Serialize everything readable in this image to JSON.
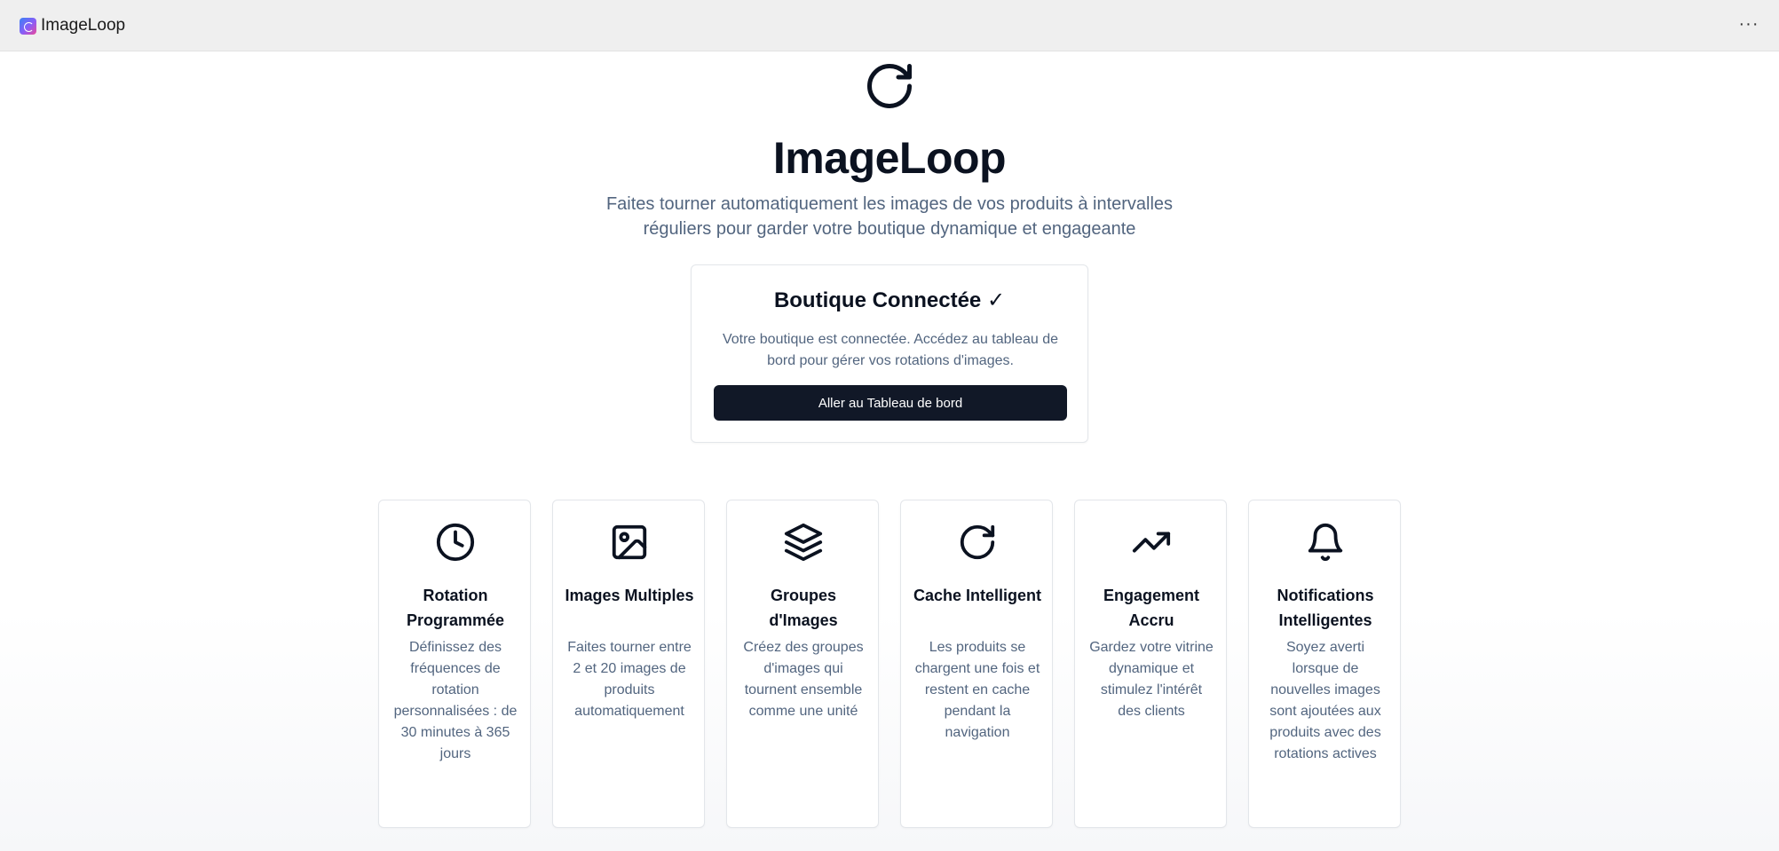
{
  "window": {
    "title": "ImageLoop",
    "menu_label": "···"
  },
  "hero": {
    "icon": "refresh-icon",
    "title": "ImageLoop",
    "subtitle": "Faites tourner automatiquement les images de vos produits à intervalles réguliers pour garder votre boutique dynamique et engageante"
  },
  "connected_card": {
    "title": "Boutique Connectée ✓",
    "description": "Votre boutique est connectée. Accédez au tableau de bord pour gérer vos rotations d'images.",
    "button_label": "Aller au Tableau de bord"
  },
  "features": [
    {
      "icon": "clock-icon",
      "title": "Rotation Programmée",
      "description": "Définissez des fréquences de rotation personnalisées : de 30 minutes à 365 jours"
    },
    {
      "icon": "image-icon",
      "title": "Images Multiples",
      "description": "Faites tourner entre 2 et 20 images de produits automatiquement"
    },
    {
      "icon": "layers-icon",
      "title": "Groupes d'Images",
      "description": "Créez des groupes d'images qui tournent ensemble comme une unité"
    },
    {
      "icon": "refresh-icon",
      "title": "Cache Intelligent",
      "description": "Les produits se chargent une fois et restent en cache pendant la navigation"
    },
    {
      "icon": "trending-up-icon",
      "title": "Engagement Accru",
      "description": "Gardez votre vitrine dynamique et stimulez l'intérêt des clients"
    },
    {
      "icon": "bell-icon",
      "title": "Notifications Intelligentes",
      "description": "Soyez averti lorsque de nouvelles images sont ajoutées aux produits avec des rotations actives"
    }
  ],
  "colors": {
    "primary_dark": "#111827",
    "text_muted": "#52657f",
    "border": "#e3e6ea",
    "titlebar_bg": "#efefef"
  }
}
